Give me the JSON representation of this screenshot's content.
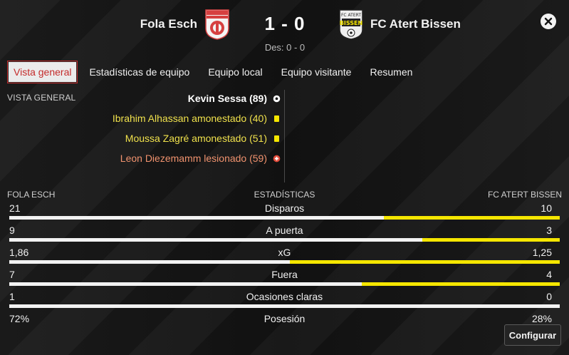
{
  "header": {
    "home_team": "Fola Esch",
    "away_team": "FC Atert Bissen",
    "score": "1 - 0",
    "halftime": "Des: 0 - 0",
    "home_crest_icon": "fola-esch-crest-icon",
    "away_crest_icon": "atert-bissen-crest-icon",
    "away_crest_text_top": "FC ATERT",
    "away_crest_text_main": "BISSEN",
    "close_icon": "close-icon"
  },
  "tabs": [
    {
      "label": "Vista general",
      "active": true
    },
    {
      "label": "Estadísticas de equipo",
      "active": false
    },
    {
      "label": "Equipo local",
      "active": false
    },
    {
      "label": "Equipo visitante",
      "active": false
    },
    {
      "label": "Resumen",
      "active": false
    }
  ],
  "overview": {
    "label": "VISTA GENERAL",
    "events": [
      {
        "text": "Kevin Sessa (89)",
        "type": "goal",
        "icon": "football-icon"
      },
      {
        "text": "Ibrahim Alhassan amonestado (40)",
        "type": "card",
        "icon": "yellow-card-icon"
      },
      {
        "text": "Moussa Zagré amonestado (51)",
        "type": "card",
        "icon": "yellow-card-icon"
      },
      {
        "text": "Leon Diezemamm lesionado (59)",
        "type": "injury",
        "icon": "injury-icon"
      }
    ]
  },
  "stats": {
    "home_label": "FOLA ESCH",
    "center_label": "ESTADÍSTICAS",
    "away_label": "FC ATERT BISSEN",
    "rows": [
      {
        "name": "Disparos",
        "home": "21",
        "away": "10",
        "away_share": 0.32
      },
      {
        "name": "A puerta",
        "home": "9",
        "away": "3",
        "away_share": 0.25
      },
      {
        "name": "xG",
        "home": "1,86",
        "away": "1,25",
        "away_share": 0.49
      },
      {
        "name": "Fuera",
        "home": "7",
        "away": "4",
        "away_share": 0.36
      },
      {
        "name": "Ocasiones claras",
        "home": "1",
        "away": "0",
        "away_share": 0.0
      },
      {
        "name": "Posesión",
        "home": "72%",
        "away": "28%",
        "away_share": 0.28
      }
    ]
  },
  "footer": {
    "configure_label": "Configurar"
  },
  "colors": {
    "accent_red": "#c42b2b",
    "away_bar": "#f5e600",
    "card": "#f0e14c",
    "injury": "#e04a3a"
  }
}
